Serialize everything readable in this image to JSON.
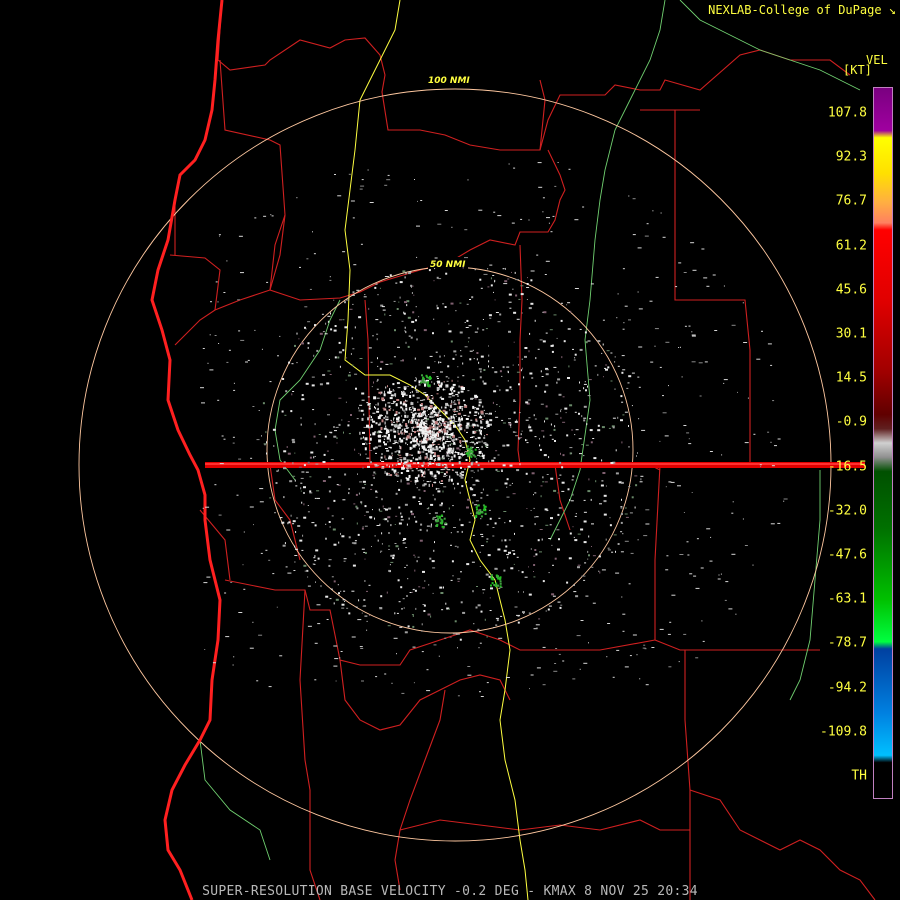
{
  "header": {
    "credit": "NEXLAB-College of DuPage ↘"
  },
  "legend": {
    "product_label": "VEL",
    "unit_label": "[KT]",
    "ticks": [
      "107.8",
      "92.3",
      "76.7",
      "61.2",
      "45.6",
      "30.1",
      "14.5",
      "-0.9",
      "-16.5",
      "-32.0",
      "-47.6",
      "-63.1",
      "-78.7",
      "-94.2",
      "-109.8",
      "TH"
    ]
  },
  "range_rings": [
    "100 NMI",
    "50 NMI"
  ],
  "caption": "SUPER-RESOLUTION BASE VELOCITY -0.2 DEG - KMAX 8 NOV 25 20:34",
  "colors": {
    "county_border": "#d02020",
    "highway": "#ffff40",
    "river": "#70d070",
    "range_ring": "#ffc8a0",
    "coastline": "#ff2020",
    "text": "#ffff40"
  }
}
